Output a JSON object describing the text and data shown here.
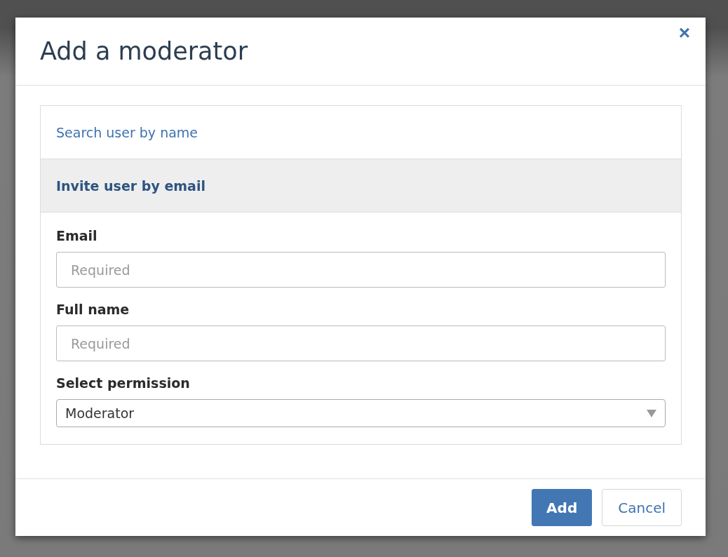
{
  "dialog": {
    "title": "Add a moderator",
    "close": "×"
  },
  "sections": [
    {
      "title": "Search user by name",
      "expanded": false
    },
    {
      "title": "Invite user by email",
      "expanded": true
    }
  ],
  "form": {
    "fields": [
      {
        "kind": "text",
        "label": "Email",
        "placeholder": "Required"
      },
      {
        "kind": "text",
        "label": "Full name",
        "placeholder": "Required"
      },
      {
        "kind": "select",
        "label": "Select permission",
        "value": "Moderator"
      }
    ]
  },
  "buttons": [
    {
      "label": "Add",
      "kind": "primary"
    },
    {
      "label": "Cancel",
      "kind": "secondary"
    }
  ]
}
